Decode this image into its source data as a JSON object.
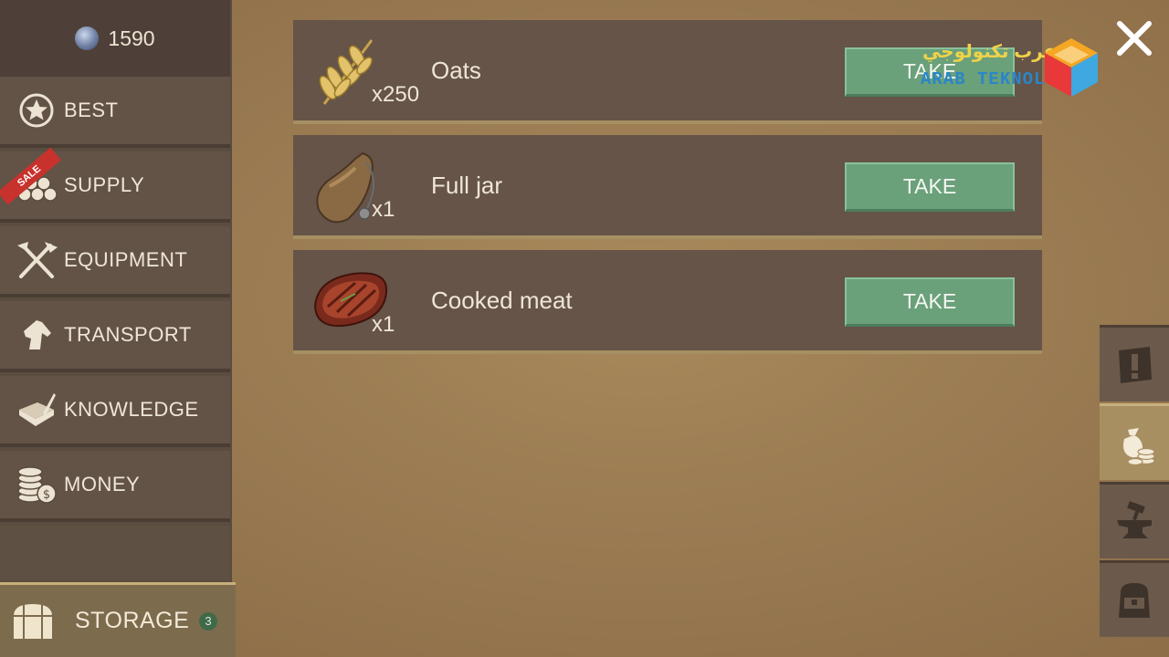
{
  "currency": {
    "amount": "1590",
    "icon": "gem-icon"
  },
  "menu": {
    "items": [
      {
        "label": "BEST",
        "icon": "star-badge-icon"
      },
      {
        "label": "SUPPLY",
        "icon": "logs-icon",
        "ribbon": "SALE"
      },
      {
        "label": "EQUIPMENT",
        "icon": "crossed-tools-icon"
      },
      {
        "label": "TRANSPORT",
        "icon": "horse-head-icon"
      },
      {
        "label": "KNOWLEDGE",
        "icon": "book-quill-icon"
      },
      {
        "label": "MONEY",
        "icon": "coins-icon"
      }
    ],
    "storage": {
      "label": "STORAGE",
      "count": "3",
      "icon": "chest-icon"
    }
  },
  "items": [
    {
      "name": "Oats",
      "qty": "x250",
      "icon": "oats-icon",
      "button": "TAKE"
    },
    {
      "name": "Full jar",
      "qty": "x1",
      "icon": "jar-icon",
      "button": "TAKE"
    },
    {
      "name": "Cooked meat",
      "qty": "x1",
      "icon": "steak-icon",
      "button": "TAKE"
    }
  ],
  "watermark": {
    "arabic": "عرب تكنولوجي",
    "latin": "ARAB TEKNOLOGI"
  },
  "colors": {
    "take_button": "#6aa07a",
    "menu_bg": "#635347",
    "storage_active": "#7d6b4e",
    "background": "#9a7b52"
  },
  "right_rail": [
    "alert-icon",
    "coins-bag-icon",
    "anvil-icon",
    "backpack-icon"
  ]
}
